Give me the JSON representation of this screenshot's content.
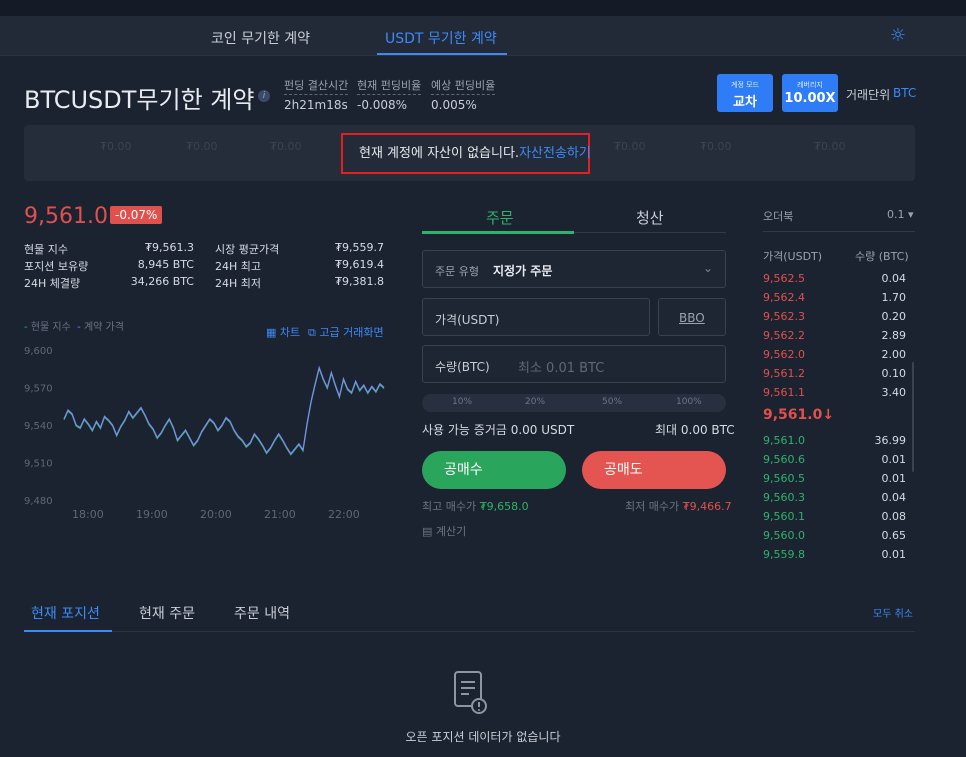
{
  "nav": {
    "tab_coin": "코인 무기한 계약",
    "tab_usdt": "USDT 무기한 계약",
    "theme_icon": "sun-icon"
  },
  "header": {
    "title": "BTCUSDT무기한 계약",
    "funding_time_label": "펀딩 결산시간",
    "funding_time_value": "2h21m18s",
    "funding_rate_label": "현재 펀딩비율",
    "funding_rate_value": "-0.008%",
    "expected_rate_label": "예상 펀딩비율",
    "expected_rate_value": "0.005%",
    "mode_small": "계정 모드",
    "mode_label": "교차",
    "leverage_small": "레버리지",
    "leverage_value": "10.00X",
    "unit_label": "거래단위",
    "unit_value": "BTC"
  },
  "account": {
    "notice_text": "현재 계정에 자산이 없습니다.",
    "notice_link": "자산전송하기",
    "ghost": [
      "₮0.00",
      "₮0.00",
      "₮0.00",
      "₮0.00",
      "₮0.00",
      "₮0.00"
    ]
  },
  "market": {
    "price": "9,561.0",
    "change": "-0.07%",
    "stats": [
      {
        "label": "현물 지수",
        "value": "₮9,561.3",
        "label2": "시장 평균가격",
        "value2": "₮9,559.7"
      },
      {
        "label": "포지션 보유량",
        "value": "8,945 BTC",
        "label2": "24H 최고",
        "value2": "₮9,619.4"
      },
      {
        "label": "24H 체결량",
        "value": "34,266 BTC",
        "label2": "24H 최저",
        "value2": "₮9,381.8"
      }
    ],
    "legend_spot": "현물 지수",
    "legend_contract": "계약 가격",
    "link_chart": "차트",
    "link_advanced": "고급 거래화면"
  },
  "chart_data": {
    "type": "line",
    "x_ticks": [
      "18:00",
      "19:00",
      "20:00",
      "21:00",
      "22:00"
    ],
    "y_ticks": [
      9600,
      9570,
      9540,
      9510,
      9480
    ],
    "ylim": [
      9480,
      9600
    ],
    "grid": false,
    "series": [
      {
        "name": "현물 지수",
        "color": "#2fb36a"
      },
      {
        "name": "계약 가격",
        "color": "#7b8cf0"
      }
    ],
    "values": [
      9545,
      9552,
      9549,
      9540,
      9538,
      9545,
      9541,
      9536,
      9543,
      9538,
      9547,
      9544,
      9540,
      9532,
      9539,
      9544,
      9551,
      9546,
      9550,
      9554,
      9548,
      9541,
      9537,
      9530,
      9534,
      9540,
      9545,
      9538,
      9528,
      9532,
      9536,
      9530,
      9524,
      9528,
      9535,
      9540,
      9545,
      9542,
      9536,
      9540,
      9546,
      9543,
      9536,
      9531,
      9528,
      9523,
      9526,
      9533,
      9529,
      9524,
      9518,
      9522,
      9528,
      9533,
      9528,
      9522,
      9517,
      9521,
      9525,
      9520,
      9541,
      9559,
      9573,
      9586,
      9577,
      9570,
      9582,
      9572,
      9563,
      9577,
      9569,
      9566,
      9575,
      9568,
      9572,
      9566,
      9571,
      9567,
      9573,
      9570
    ]
  },
  "order": {
    "tab_open": "주문",
    "tab_close": "청산",
    "type_label": "주문 유형",
    "type_value": "지정가 주문",
    "price_label": "가격(USDT)",
    "bbo": "BBO",
    "qty_label": "수량(BTC)",
    "qty_placeholder": "최소 0.01 BTC",
    "pcts": [
      "10%",
      "20%",
      "50%",
      "100%"
    ],
    "avail_label": "사용 가능 증거금 0.00 USDT",
    "max_label": "최대 0.00 BTC",
    "buy_label": "공매수",
    "sell_label": "공매도",
    "max_buy_label": "최고 매수가",
    "max_buy_value": "₮9,658.0",
    "min_sell_label": "최저 매수가",
    "min_sell_value": "₮9,466.7",
    "calculator": "계산기"
  },
  "orderbook": {
    "title": "오더북",
    "precision": "0.1",
    "col_price": "가격(USDT)",
    "col_qty": "수량 (BTC)",
    "asks": [
      {
        "p": "9,562.5",
        "q": "0.04"
      },
      {
        "p": "9,562.4",
        "q": "1.70"
      },
      {
        "p": "9,562.3",
        "q": "0.20"
      },
      {
        "p": "9,562.2",
        "q": "2.89"
      },
      {
        "p": "9,562.0",
        "q": "2.00"
      },
      {
        "p": "9,561.2",
        "q": "0.10"
      },
      {
        "p": "9,561.1",
        "q": "3.40"
      }
    ],
    "mid": "9,561.0↓",
    "bids": [
      {
        "p": "9,561.0",
        "q": "36.99"
      },
      {
        "p": "9,560.6",
        "q": "0.01"
      },
      {
        "p": "9,560.5",
        "q": "0.01"
      },
      {
        "p": "9,560.3",
        "q": "0.04"
      },
      {
        "p": "9,560.1",
        "q": "0.08"
      },
      {
        "p": "9,560.0",
        "q": "0.65"
      },
      {
        "p": "9,559.8",
        "q": "0.01"
      }
    ]
  },
  "bottom": {
    "tab_positions": "현재 포지션",
    "tab_orders": "현재 주문",
    "tab_history": "주문 내역",
    "cancel_all": "모두 취소",
    "empty_text": "오픈 포지션 데이터가 없습니다"
  }
}
